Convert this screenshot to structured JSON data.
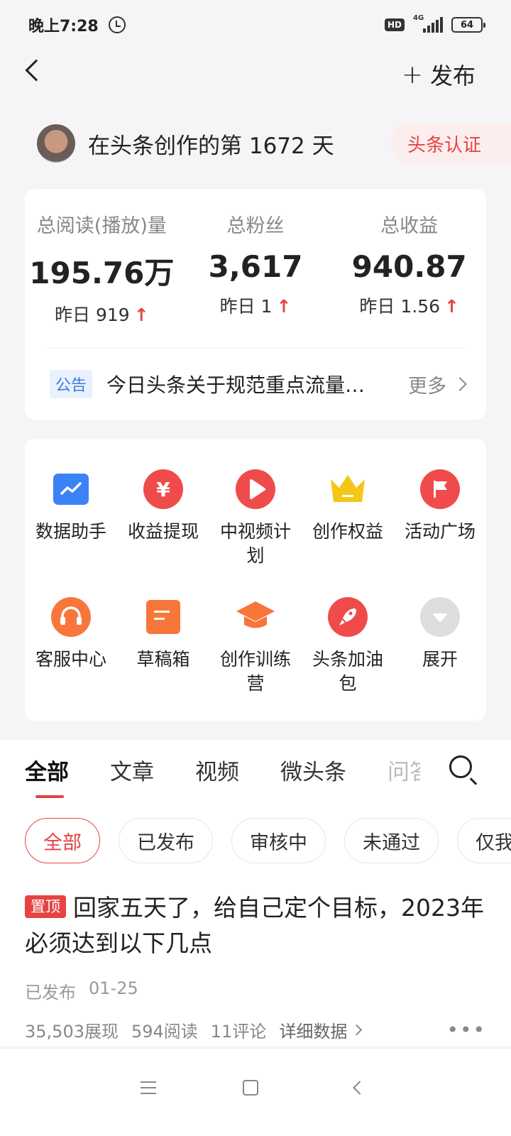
{
  "status_bar": {
    "time": "晚上7:28",
    "hd": "HD",
    "network": "4G",
    "battery": "64"
  },
  "header": {
    "publish_label": "发布",
    "publish_icon": "+"
  },
  "profile": {
    "creation_text": "在头条创作的第 1672 天",
    "cert_label": "头条认证"
  },
  "stats": [
    {
      "label": "总阅读(播放)量",
      "value": "195.76万",
      "yesterday": "昨日 919"
    },
    {
      "label": "总粉丝",
      "value": "3,617",
      "yesterday": "昨日 1"
    },
    {
      "label": "总收益",
      "value": "940.87",
      "yesterday": "昨日 1.56"
    }
  ],
  "notice": {
    "badge": "公告",
    "text": "今日头条关于规范重点流量环境的公告",
    "more": "更多"
  },
  "tools": [
    {
      "label": "数据助手",
      "icon": "chart-icon"
    },
    {
      "label": "收益提现",
      "icon": "yuan-icon"
    },
    {
      "label": "中视频计划",
      "icon": "play-icon"
    },
    {
      "label": "创作权益",
      "icon": "crown-icon"
    },
    {
      "label": "活动广场",
      "icon": "flag-icon"
    },
    {
      "label": "客服中心",
      "icon": "headset-icon"
    },
    {
      "label": "草稿箱",
      "icon": "draft-icon"
    },
    {
      "label": "创作训练营",
      "icon": "graduation-icon"
    },
    {
      "label": "头条加油包",
      "icon": "rocket-icon"
    },
    {
      "label": "展开",
      "icon": "expand-icon"
    }
  ],
  "tabs": [
    "全部",
    "文章",
    "视频",
    "微头条",
    "问答"
  ],
  "filters": [
    "全部",
    "已发布",
    "审核中",
    "未通过",
    "仅我可见"
  ],
  "article": {
    "pin": "置顶",
    "title": "回家五天了，给自己定个目标，2023年必须达到以下几点",
    "status": "已发布",
    "date": "01-25",
    "impressions": "35,503展现",
    "reads": "594阅读",
    "comments": "11评论",
    "detail": "详细数据"
  },
  "colors": {
    "accent": "#e64343",
    "blue": "#3b82f6",
    "orange": "#f7763a",
    "gold": "#f5c518"
  }
}
